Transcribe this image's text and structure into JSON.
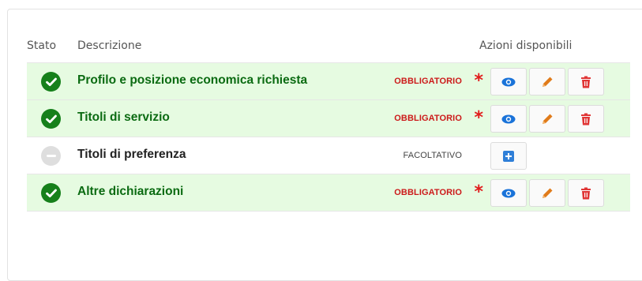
{
  "table": {
    "headers": {
      "stato": "Stato",
      "descrizione": "Descrizione",
      "azioni": "Azioni disponibili"
    },
    "rows": [
      {
        "status": "complete",
        "description": "Profilo e posizione economica richiesta",
        "requirement": "OBBLIGATORIO",
        "required": true,
        "actions": [
          "view",
          "edit",
          "delete"
        ]
      },
      {
        "status": "complete",
        "description": "Titoli di servizio",
        "requirement": "OBBLIGATORIO",
        "required": true,
        "actions": [
          "view",
          "edit",
          "delete"
        ]
      },
      {
        "status": "empty",
        "description": "Titoli di preferenza",
        "requirement": "FACOLTATIVO",
        "required": false,
        "actions": [
          "add"
        ]
      },
      {
        "status": "complete",
        "description": "Altre dichiarazioni",
        "requirement": "OBBLIGATORIO",
        "required": true,
        "actions": [
          "view",
          "edit",
          "delete"
        ]
      }
    ]
  },
  "icons": {
    "complete": "check-circle-icon",
    "empty": "minus-circle-icon",
    "view": "eye-icon",
    "edit": "pencil-icon",
    "delete": "trash-icon",
    "add": "plus-square-icon",
    "required": "asterisk-icon"
  },
  "colors": {
    "complete_bg": "#e6fbe1",
    "complete_text": "#0b6b12",
    "check_fill": "#16801b",
    "required": "#cc1a1a",
    "view": "#1a73d9",
    "edit": "#e07b1a",
    "delete": "#e03535",
    "add": "#2f7fd8"
  }
}
